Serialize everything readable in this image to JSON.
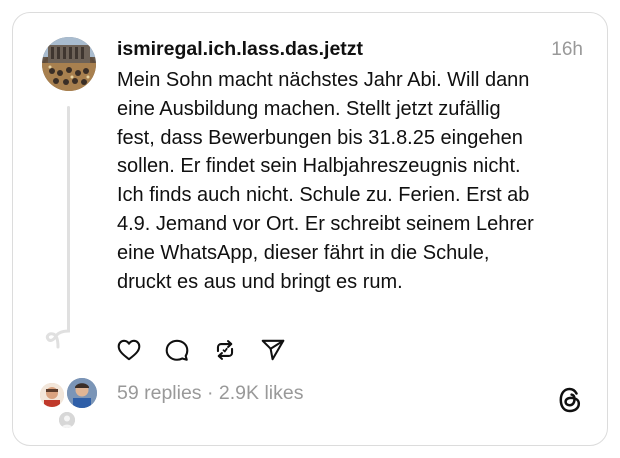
{
  "post": {
    "username": "ismiregal.ich.lass.das.jetzt",
    "timestamp": "16h",
    "text_lines": [
      "Mein Sohn macht nächstes Jahr Abi. Will dann",
      "eine Ausbildung machen. Stellt jetzt zufällig",
      "fest, dass Bewerbungen bis 31.8.25 eingehen",
      "sollen. Er findet sein Halbjahreszeugnis nicht.",
      "Ich finds auch nicht. Schule zu. Ferien. Erst ab",
      "4.9. Jemand vor Ort. Er schreibt seinem Lehrer",
      "eine WhatsApp, dieser fährt in die Schule,",
      "druckt es aus und bringt es rum."
    ],
    "actions": [
      {
        "name": "like",
        "icon": "heart-icon"
      },
      {
        "name": "reply",
        "icon": "comment-icon"
      },
      {
        "name": "repost",
        "icon": "repost-icon"
      },
      {
        "name": "share",
        "icon": "send-icon"
      }
    ],
    "replies_count": "59 replies",
    "separator": "·",
    "likes_count": "2.9K likes",
    "stats_text": "59 replies · 2.9K likes"
  },
  "branding": {
    "logo": "threads-logo-icon"
  },
  "colors": {
    "text": "#101010",
    "muted": "#999999",
    "border": "#dcdcdc",
    "thread_line": "#e0e0e0"
  }
}
